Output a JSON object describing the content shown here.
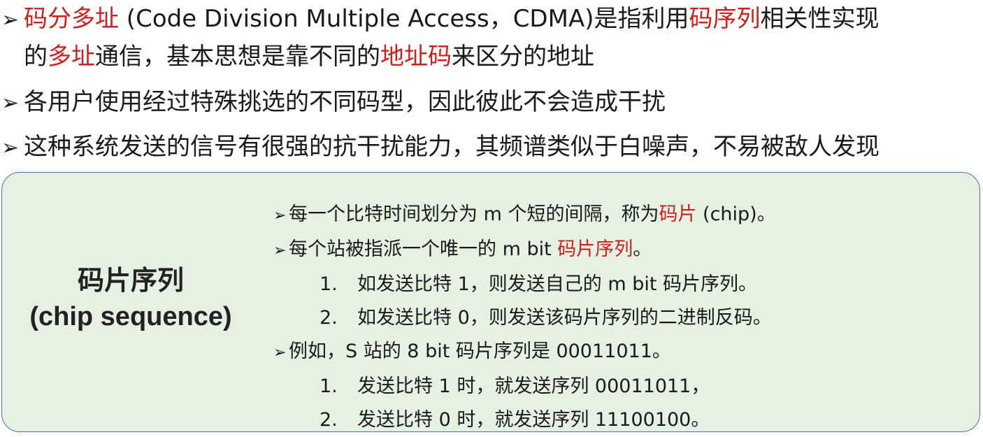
{
  "bullet_marker": "➢",
  "bullets": [
    {
      "seg1_red": "码分多址",
      "seg2": " (Code Division Multiple Access，CDMA)是指利用",
      "seg3_red": "码序列",
      "seg4": "相关性实现",
      "line2_seg1": "的",
      "line2_seg2_red": "多址",
      "line2_seg3": "通信，基本思想是靠不同的",
      "line2_seg4_red": "地址码",
      "line2_seg5": "来区分的地址"
    },
    {
      "text": "各用户使用经过特殊挑选的不同码型，因此彼此不会造成干扰"
    },
    {
      "text": "这种系统发送的信号有很强的抗干扰能力，其频谱类似于白噪声，不易被敌人发现"
    }
  ],
  "box": {
    "title_cn": "码片序列",
    "title_en": "(chip sequence)",
    "item_marker": "➢",
    "items": [
      {
        "seg1": "每一个比特时间划分为 m 个短的间隔，称为",
        "seg2_red": "码片",
        "seg3": " (chip)。"
      },
      {
        "seg1": "每个站被指派一个唯一的 m bit ",
        "seg2_red": "码片序列",
        "seg3": "。"
      },
      {
        "num": "1.",
        "text": "如发送比特 1，则发送自己的 m bit 码片序列。"
      },
      {
        "num": "2.",
        "text": "如发送比特 0，则发送该码片序列的二进制反码。"
      },
      {
        "text": "例如，S 站的 8 bit 码片序列是 00011011。"
      },
      {
        "num": "1.",
        "text": "发送比特 1 时，就发送序列 00011011，"
      },
      {
        "num": "2.",
        "text": "发送比特 0 时，就发送序列 11100100。"
      }
    ]
  },
  "colors": {
    "highlight_red": "#cc1f1f",
    "box_background": "#e6f0e3",
    "box_border": "#4a6fb0"
  }
}
